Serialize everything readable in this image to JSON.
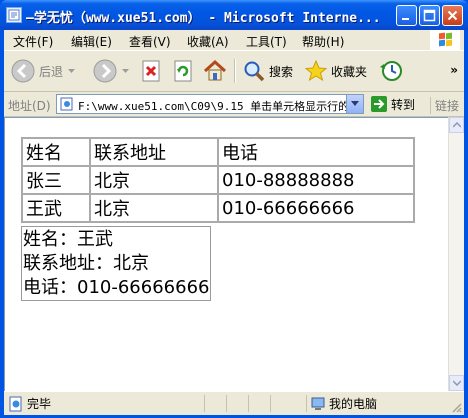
{
  "window": {
    "title": "—学无忧（www.xue51.com） - Microsoft Interne...",
    "colors": {
      "titlebar": "#0058e6",
      "frame": "#ece9d8",
      "close_button": "#c63d1a"
    }
  },
  "menu": {
    "items": [
      "文件(F)",
      "编辑(E)",
      "查看(V)",
      "收藏(A)",
      "工具(T)",
      "帮助(H)"
    ]
  },
  "toolbar": {
    "back_label": "后退",
    "search_label": "搜索",
    "favorites_label": "收藏夹",
    "chevron": "»"
  },
  "address": {
    "label": "地址(D)",
    "value": "F:\\www.xue51.com\\C09\\9.15 单击单元格显示行的详",
    "go_label": "转到",
    "links_label": "链接"
  },
  "table": {
    "headers": [
      "姓名",
      "联系地址",
      "电话"
    ],
    "rows": [
      [
        "张三",
        "北京",
        "010-88888888"
      ],
      [
        "王武",
        "北京",
        "010-66666666"
      ]
    ]
  },
  "detail": {
    "name_line": "姓名：王武",
    "address_line": "联系地址：北京",
    "phone_line": "电话：010-66666666"
  },
  "status": {
    "done_label": "完毕",
    "zone_label": "我的电脑"
  }
}
